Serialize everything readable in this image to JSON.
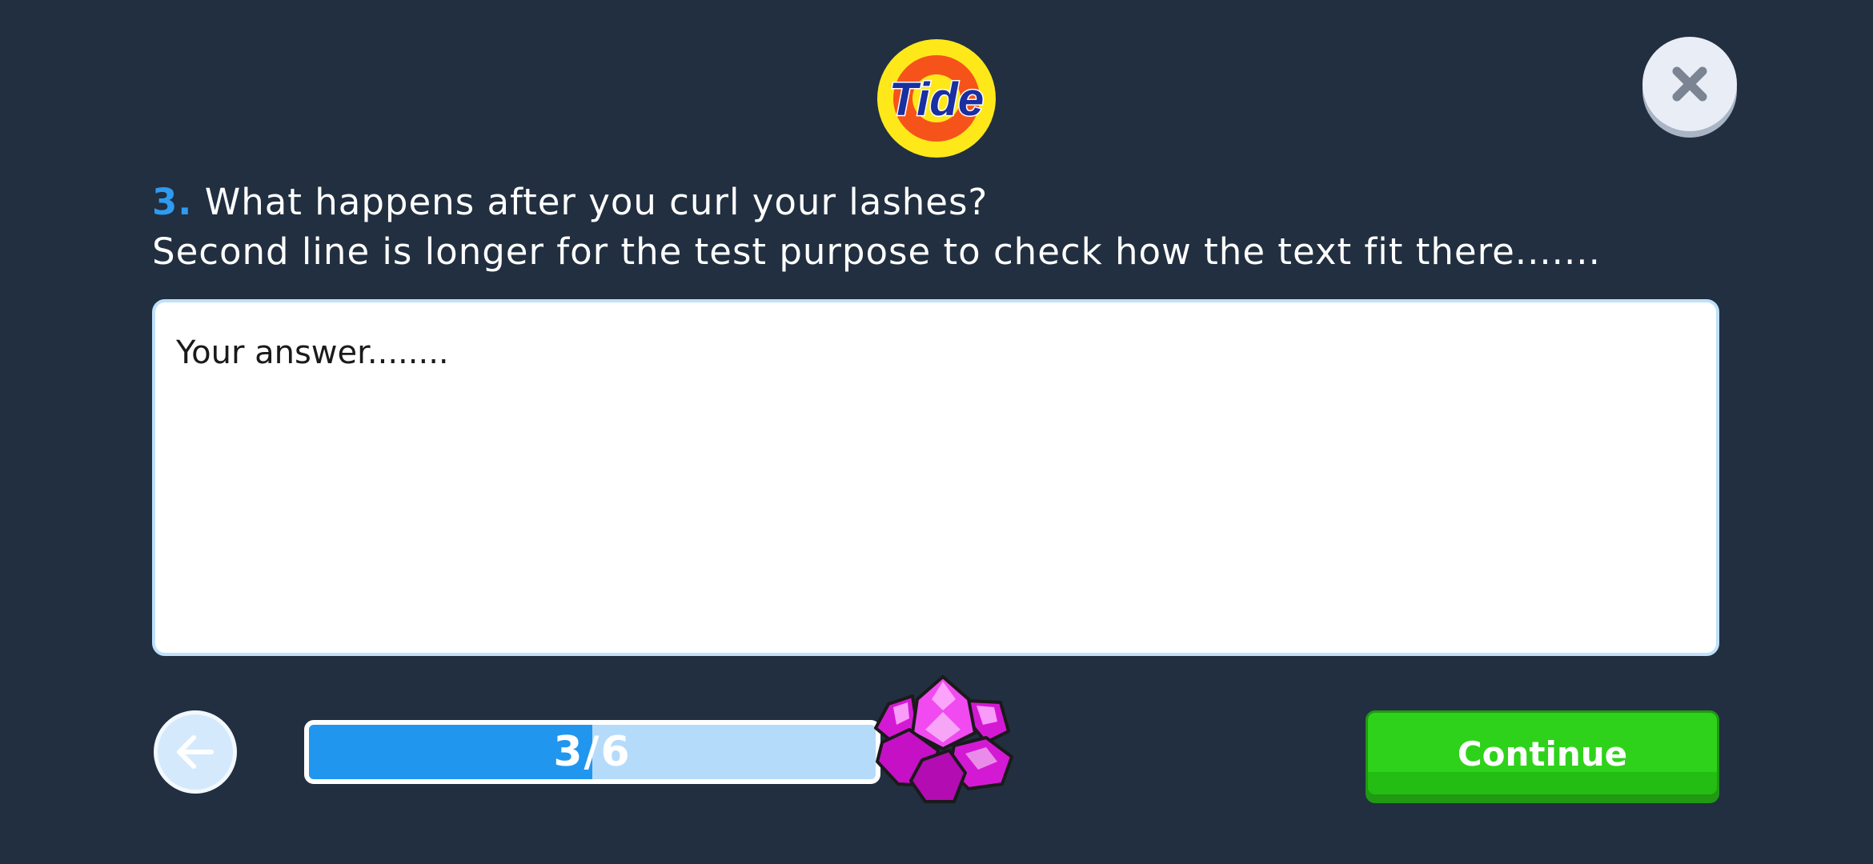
{
  "brand": {
    "name": "Tide"
  },
  "question": {
    "number": "3.",
    "line1": "What happens after you curl your lashes?",
    "line2": "Second line is longer for the test purpose to check how the text fit there......."
  },
  "answer": {
    "placeholder": "Your answer........",
    "value": ""
  },
  "progress": {
    "label": "3/6",
    "current": 3,
    "total": 6
  },
  "buttons": {
    "continue_label": "Continue",
    "close_icon": "close-icon",
    "back_icon": "arrow-left-icon"
  },
  "reward": {
    "icon": "gem-icon"
  },
  "colors": {
    "background": "#212f40",
    "accent": "#2e9bf0",
    "continue": "#2fd21a",
    "gem": "#e020e0"
  }
}
